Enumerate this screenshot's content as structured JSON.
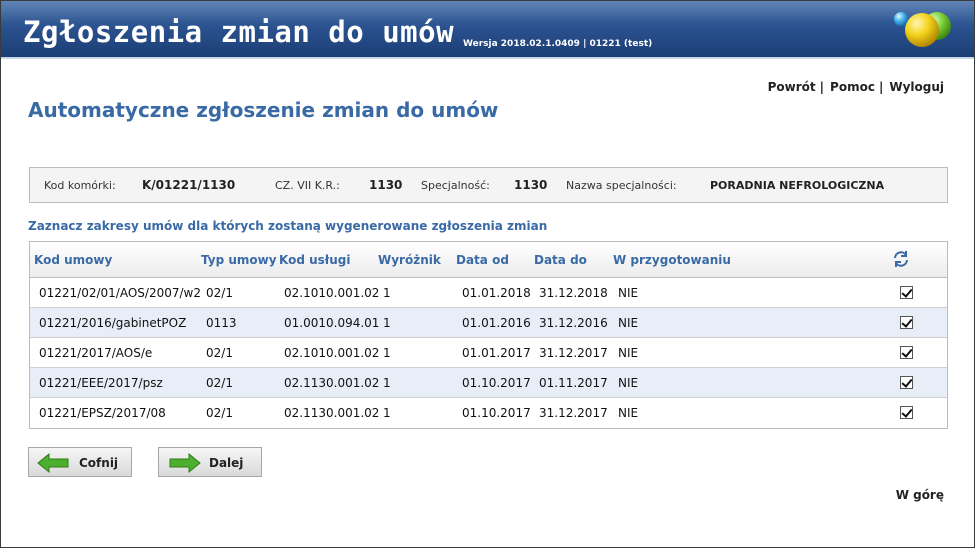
{
  "header": {
    "title": "Zgłoszenia zmian do umów",
    "version": "Wersja 2018.02.1.0409 | 01221 (test)"
  },
  "nav": {
    "back": "Powrót",
    "help": "Pomoc",
    "logout": "Wyloguj",
    "separator": "|"
  },
  "page_title": "Automatyczne zgłoszenie zmian do umów",
  "info": {
    "cell_code_label": "Kod komórki:",
    "cell_code": "K/01221/1130",
    "cz_label": "CZ. VII K.R.:",
    "cz_value": "1130",
    "spec_label": "Specjalność:",
    "spec_value": "1130",
    "spec_name_label": "Nazwa specjalności:",
    "spec_name": "PORADNIA NEFROLOGICZNA"
  },
  "section_label": "Zaznacz zakresy umów dla których zostaną wygenerowane zgłoszenia zmian",
  "table": {
    "columns": [
      "Kod umowy",
      "Typ umowy",
      "Kod usługi",
      "Wyróżnik",
      "Data od",
      "Data do",
      "W przygotowaniu"
    ],
    "refresh_icon": "refresh-icon",
    "rows": [
      {
        "kod": "01221/02/01/AOS/2007/w2",
        "typ": "02/1",
        "usluga": "02.1010.001.02",
        "wyroznik": "1",
        "od": "01.01.2018",
        "do": "31.12.2018",
        "przyg": "NIE",
        "checked": true
      },
      {
        "kod": "01221/2016/gabinetPOZ",
        "typ": "0113",
        "usluga": "01.0010.094.01",
        "wyroznik": "1",
        "od": "01.01.2016",
        "do": "31.12.2016",
        "przyg": "NIE",
        "checked": true
      },
      {
        "kod": "01221/2017/AOS/e",
        "typ": "02/1",
        "usluga": "02.1010.001.02",
        "wyroznik": "1",
        "od": "01.01.2017",
        "do": "31.12.2017",
        "przyg": "NIE",
        "checked": true
      },
      {
        "kod": "01221/EEE/2017/psz",
        "typ": "02/1",
        "usluga": "02.1130.001.02",
        "wyroznik": "1",
        "od": "01.10.2017",
        "do": "01.11.2017",
        "przyg": "NIE",
        "checked": true
      },
      {
        "kod": "01221/EPSZ/2017/08",
        "typ": "02/1",
        "usluga": "02.1130.001.02",
        "wyroznik": "1",
        "od": "01.10.2017",
        "do": "31.12.2017",
        "przyg": "NIE",
        "checked": true
      }
    ]
  },
  "buttons": {
    "back": "Cofnij",
    "next": "Dalej"
  },
  "to_top": "W górę",
  "colors": {
    "accent": "#3a6aa6",
    "header_dark": "#1b3d75",
    "alt_row": "#e8eef8",
    "arrow_green": "#4caf2e"
  }
}
